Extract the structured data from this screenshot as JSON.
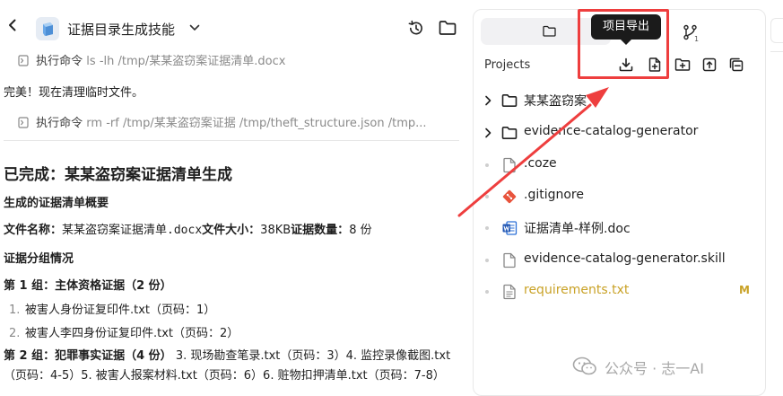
{
  "header": {
    "title": "证据目录生成技能",
    "back_icon": "chevron-left-icon",
    "app_icon": "app-cube-icon",
    "history_icon": "history-icon",
    "folder_icon": "folder-icon"
  },
  "chat": {
    "cmd1": {
      "label": "执行命令",
      "args": "ls -lh /tmp/某某盗窃案证据清单.docx"
    },
    "done_note": "完美！现在清理临时文件。",
    "cmd2": {
      "label": "执行命令",
      "args": "rm -rf /tmp/某某盗窃案证据 /tmp/theft_structure.json /tmp..."
    },
    "heading": "已完成：某某盗窃案证据清单生成",
    "summary_title": "生成的证据清单概要",
    "file_line": {
      "name_label": "文件名称：",
      "name_value": "某某盗窃案证据清单.docx",
      "size_label": "文件大小：",
      "size_value": "38KB",
      "count_label": "证据数量：",
      "count_value": "8 份"
    },
    "group_title": "证据分组情况",
    "group1_title": "第 1 组：主体资格证据（2 份）",
    "group1_items": [
      {
        "num": "1.",
        "text": "被害人身份证复印件.txt（页码：1）"
      },
      {
        "num": "2.",
        "text": "被害人李四身份证复印件.txt（页码：2）"
      }
    ],
    "group2_title": "第 2 组：犯罪事实证据（4 份）",
    "group2_rest": "3. 现场勘查笔录.txt（页码：3）4. 监控录像截图.txt（页码：4-5）5. 被害人报案材料.txt（页码：6）6. 赃物扣押清单.txt（页码：7-8）"
  },
  "panel": {
    "projects_label": "Projects",
    "git_badge": "1",
    "tooltip": "项目导出",
    "tree": [
      {
        "type": "folder",
        "name": "某某盗窃案",
        "status": ""
      },
      {
        "type": "folder",
        "name": "evidence-catalog-generator",
        "status": ""
      },
      {
        "type": "file",
        "name": ".coze",
        "status": ""
      },
      {
        "type": "git",
        "name": ".gitignore",
        "status": ""
      },
      {
        "type": "word",
        "name": "证据清单-样例.doc",
        "status": ""
      },
      {
        "type": "file",
        "name": "evidence-catalog-generator.skill",
        "status": ""
      },
      {
        "type": "text",
        "name": "requirements.txt",
        "status": "M"
      }
    ]
  },
  "watermark": {
    "text": "公众号 · 志一AI"
  },
  "colors": {
    "accent_red": "#ee3e3e",
    "modified": "#c9a227",
    "tooltip_bg": "#1b1b1b"
  }
}
